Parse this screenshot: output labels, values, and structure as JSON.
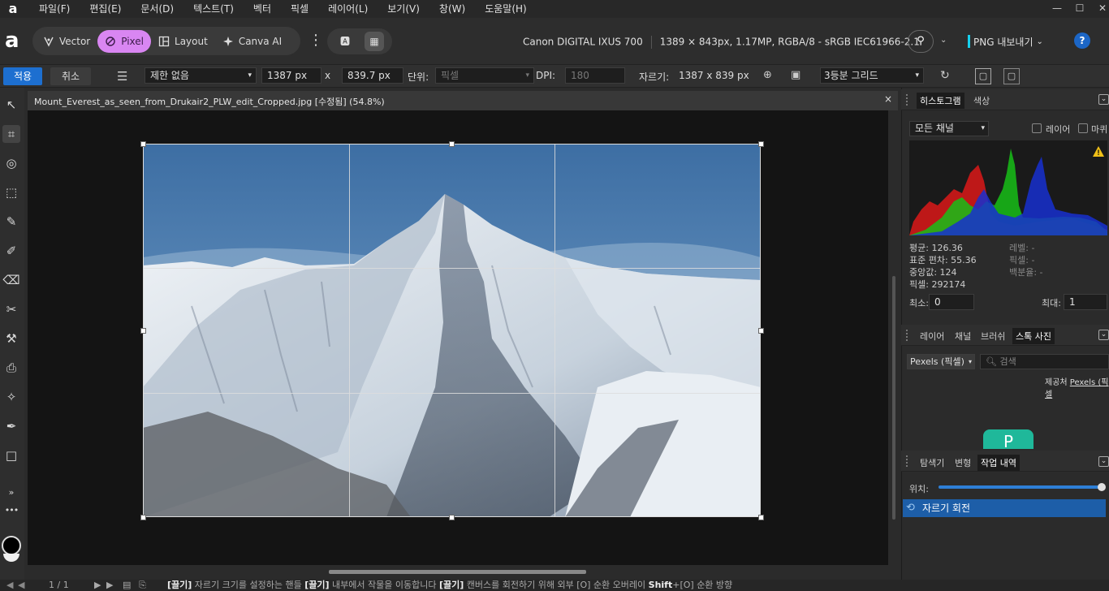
{
  "menubar": {
    "logo": "a",
    "items": [
      "파일(F)",
      "편집(E)",
      "문서(D)",
      "텍스트(T)",
      "벡터",
      "픽셀",
      "레이어(L)",
      "보기(V)",
      "창(W)",
      "도움말(H)"
    ],
    "window_controls": [
      "—",
      "☐",
      "✕"
    ]
  },
  "toolbar": {
    "app_logo": "a",
    "personas": [
      {
        "label": "Vector",
        "icon": "vector-persona-icon"
      },
      {
        "label": "Pixel",
        "icon": "pixel-persona-icon",
        "active": true
      },
      {
        "label": "Layout",
        "icon": "layout-persona-icon"
      },
      {
        "label": "Canva AI",
        "icon": "canva-ai-icon"
      }
    ],
    "camera": "Canon DIGITAL IXUS 700",
    "image_info": "1389 × 843px, 1.17MP, RGBA/8 - sRGB IEC61966-2.1",
    "export_label": "PNG 내보내기",
    "help": "?"
  },
  "context": {
    "apply_label": "적용",
    "cancel_label": "취소",
    "constraint": "제한 없음",
    "width": "1387 px",
    "x_sep": "x",
    "height": "839.7 px",
    "unit_label": "단위:",
    "unit_value": "픽셀",
    "dpi_label": "DPI:",
    "dpi_value": "180",
    "crop_label": "자르기:",
    "crop_value": "1387 x 839 px",
    "overlay": "3등분 그리드"
  },
  "document": {
    "title": "Mount_Everest_as_seen_from_Drukair2_PLW_edit_Cropped.jpg [수정됨] (54.8%)",
    "close": "×",
    "zoom_percent": 54.8
  },
  "histogram_panel": {
    "tabs": [
      "히스토그램",
      "색상"
    ],
    "active_tab": "히스토그램",
    "channel": "모든 채널",
    "layer_label": "레이어",
    "marquee_label": "마퀴",
    "stats": {
      "mean": "평균: 126.36",
      "std": "표준 편차: 55.36",
      "median": "중앙값: 124",
      "pixels": "픽셀: 292174",
      "level": "레벨: -",
      "pixel_r": "픽셀: -",
      "percent": "백분율: -"
    },
    "min_label": "최소:",
    "min_value": "0",
    "max_label": "최대:",
    "max_value": "1"
  },
  "layers_panel": {
    "tabs": [
      "레이어",
      "채널",
      "브러쉬",
      "스톡 사진"
    ],
    "active_tab": "스톡 사진",
    "source": "Pexels (픽셀)",
    "search_placeholder": "검색",
    "provider_prefix": "제공처 ",
    "provider_link": "Pexels (픽셀"
  },
  "history_panel": {
    "tabs": [
      "탐색기",
      "변형",
      "작업 내역"
    ],
    "active_tab": "작업 내역",
    "position_label": "위치:",
    "items": [
      "자르기 회전"
    ]
  },
  "status": {
    "page": "1 / 1",
    "hint_parts": [
      {
        "b": "[끌기]",
        "t": " 자르기 크기를 설정하는 핸들 "
      },
      {
        "b": "[끌기]",
        "t": " 내부에서 작물을 이동합니다 "
      },
      {
        "b": "[끌기]",
        "t": " 캔버스를 회전하기 위해 외부 "
      },
      {
        "b": "",
        "t": "[O] 순환 오버레이 "
      },
      {
        "b": "Shift",
        "t": "+[O] 순환 방향"
      }
    ]
  }
}
